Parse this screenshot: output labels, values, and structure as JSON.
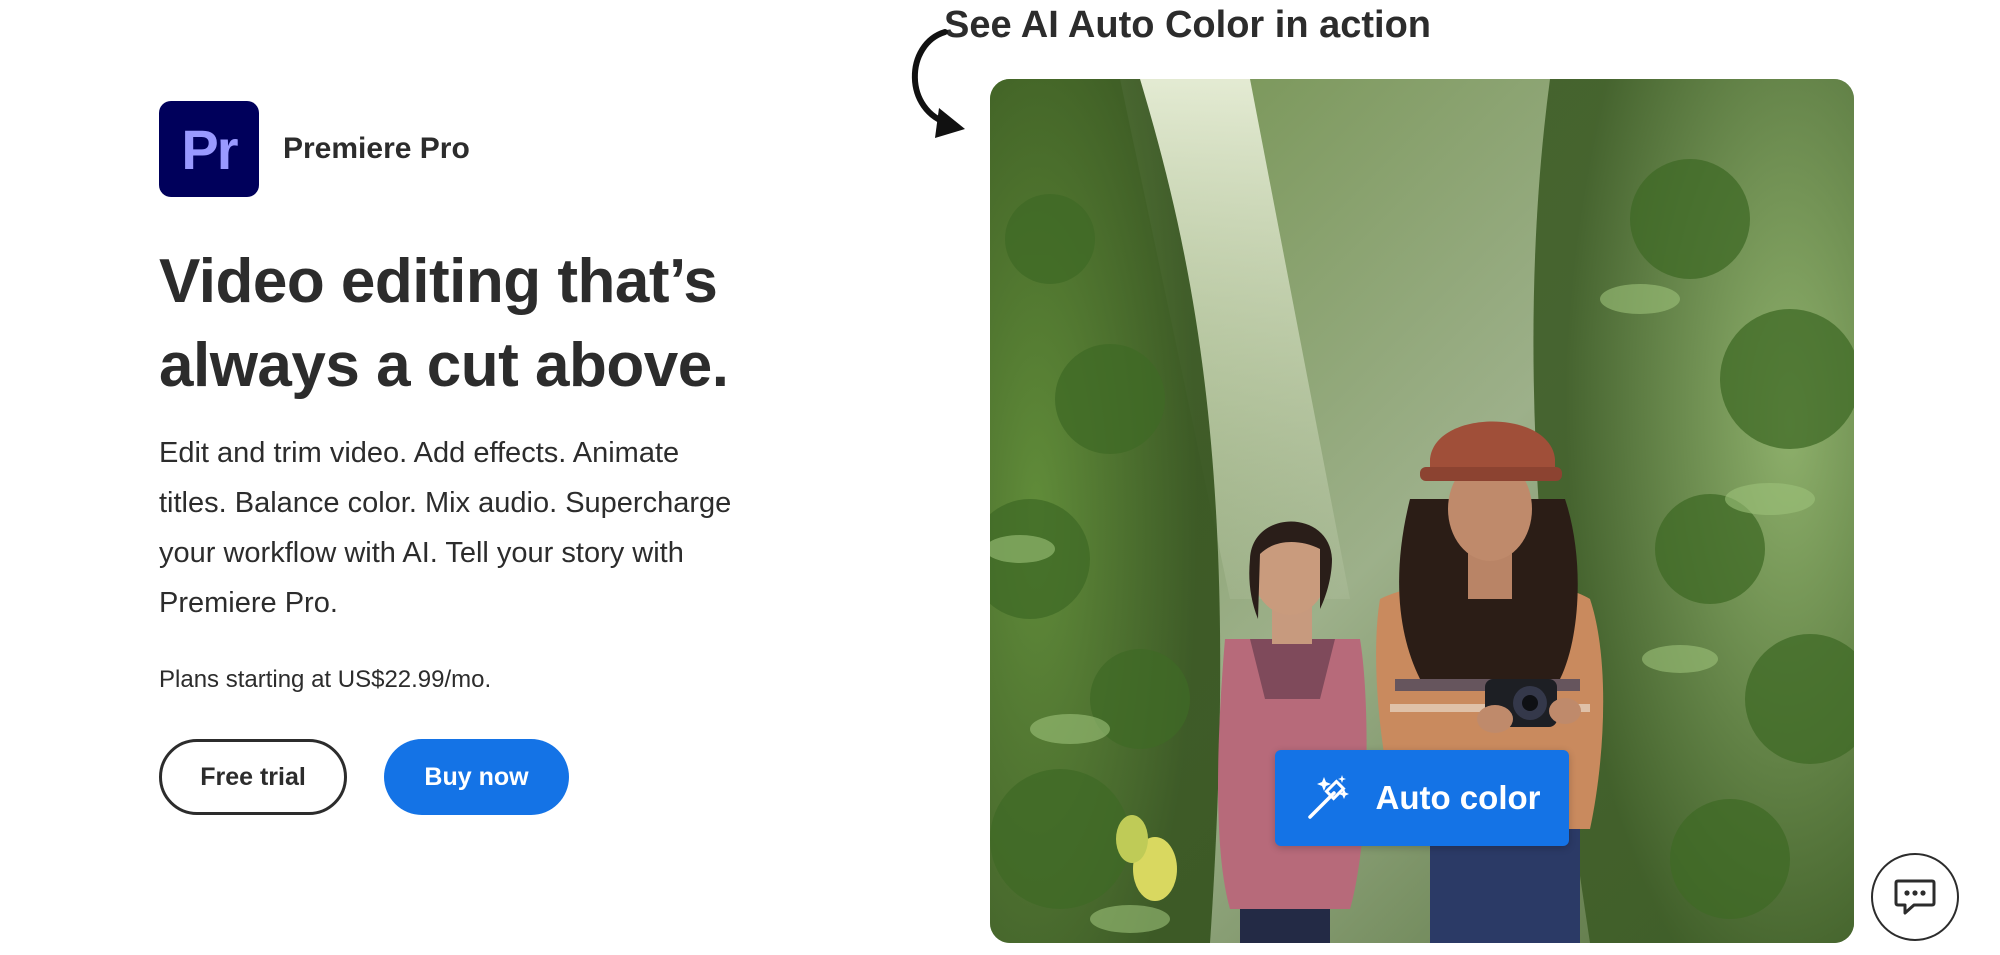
{
  "product": {
    "logo_text": "Pr",
    "name": "Premiere Pro"
  },
  "hero": {
    "headline_line1": "Video editing that’s",
    "headline_line2": "always a cut above.",
    "description": "Edit and trim video. Add effects. Animate titles. Balance color. Mix audio. Supercharge your workflow with AI. Tell your story with Premiere Pro.",
    "pricing": "Plans starting at US$22.99/mo."
  },
  "buttons": {
    "free_trial": "Free trial",
    "buy_now": "Buy now"
  },
  "media": {
    "annotation": "See AI Auto Color in action",
    "auto_color_label": "Auto color",
    "auto_color_icon": "magic-wand-icon"
  },
  "chat": {
    "icon": "chat-bubble-icon"
  },
  "colors": {
    "brand_dark": "#00005b",
    "brand_light": "#9999ff",
    "accent_blue": "#1473e6",
    "text": "#2c2c2c"
  }
}
